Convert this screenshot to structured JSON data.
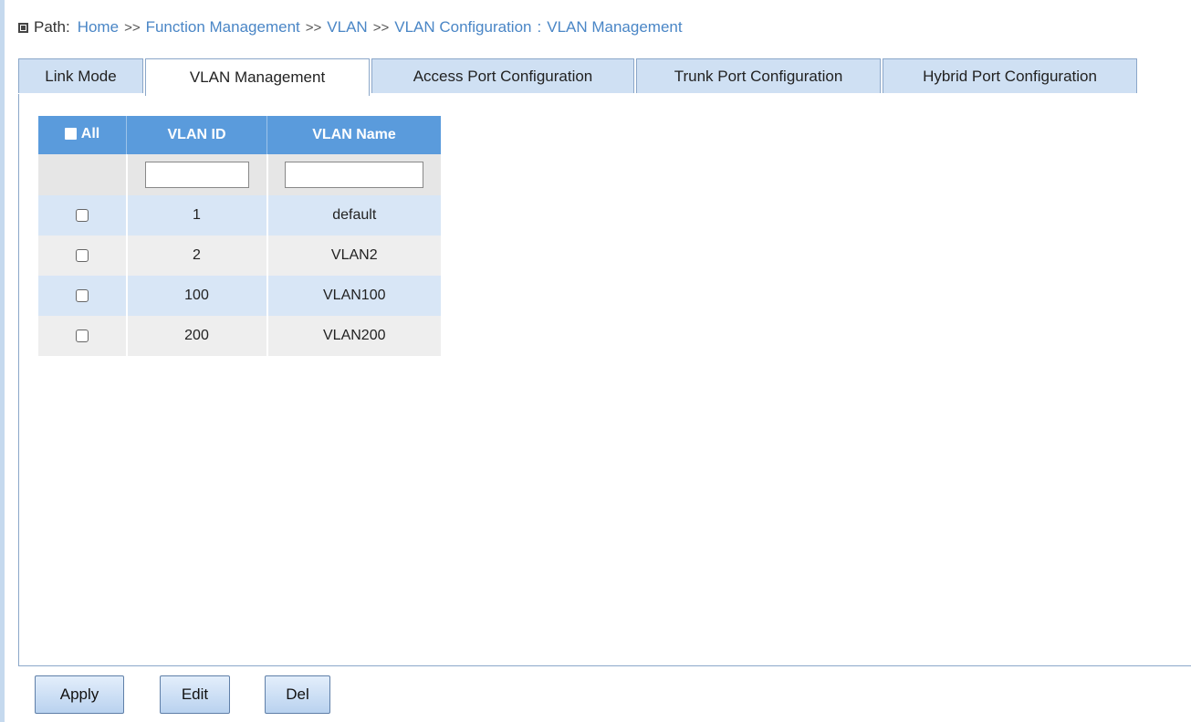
{
  "breadcrumb": {
    "path_label": "Path:",
    "items": [
      "Home",
      "Function Management",
      "VLAN",
      "VLAN Configuration"
    ],
    "separator": ">>",
    "current_separator": ":",
    "current": "VLAN Management"
  },
  "tabs": [
    {
      "label": "Link Mode",
      "active": false
    },
    {
      "label": "VLAN Management",
      "active": true
    },
    {
      "label": "Access Port Configuration",
      "active": false
    },
    {
      "label": "Trunk Port Configuration",
      "active": false
    },
    {
      "label": "Hybrid Port Configuration",
      "active": false
    }
  ],
  "table": {
    "headers": {
      "all": "All",
      "vlan_id": "VLAN ID",
      "vlan_name": "VLAN Name"
    },
    "filter": {
      "vlan_id_value": "",
      "vlan_name_value": ""
    },
    "rows": [
      {
        "id": "1",
        "name": "default",
        "checked": false
      },
      {
        "id": "2",
        "name": "VLAN2",
        "checked": false
      },
      {
        "id": "100",
        "name": "VLAN100",
        "checked": false
      },
      {
        "id": "200",
        "name": "VLAN200",
        "checked": false
      }
    ]
  },
  "buttons": {
    "apply": "Apply",
    "edit": "Edit",
    "del": "Del"
  },
  "colors": {
    "header_bg": "#5a9bdc",
    "tab_bg": "#cfe0f3",
    "link": "#4a86c6",
    "row_alt": "#d8e6f6"
  },
  "icons": {
    "path_marker": "square-bullet-icon"
  }
}
